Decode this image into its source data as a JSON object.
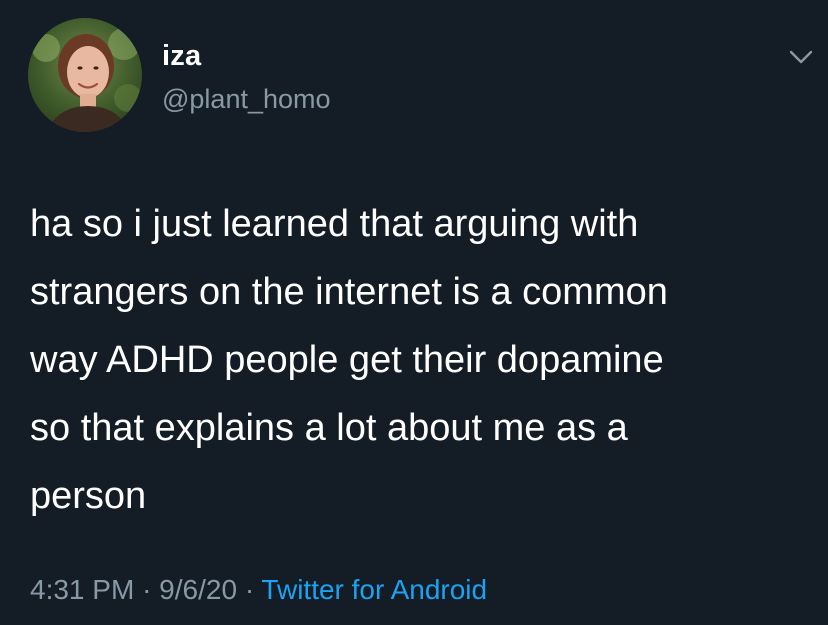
{
  "user": {
    "display_name": "iza",
    "handle": "@plant_homo",
    "avatar_icon": "profile-photo"
  },
  "tweet": {
    "lines": [
      "ha so i just learned that arguing with",
      "strangers on the internet is a common",
      "way ADHD people get their dopamine",
      "so that explains a lot about me as a",
      "person"
    ],
    "time": "4:31 PM",
    "date": "9/6/20",
    "separator": "·",
    "source": "Twitter for Android"
  },
  "icons": {
    "menu": "chevron-down-icon"
  },
  "colors": {
    "background": "#141d26",
    "text": "#ffffff",
    "secondary": "#8899a6",
    "link": "#1da1f2"
  }
}
